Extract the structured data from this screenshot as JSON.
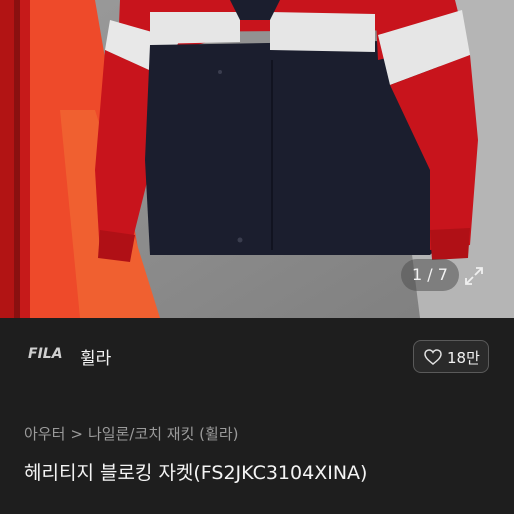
{
  "gallery": {
    "counter": "1 / 7",
    "expand_icon": "expand-arrows-icon"
  },
  "brand": {
    "logo_text": "FILA",
    "name": "휠라",
    "like_icon": "heart-outline-icon",
    "like_count": "18만"
  },
  "breadcrumb": {
    "items": [
      "아우터",
      "나일론/코치 재킷 (휠라)"
    ],
    "separator": ">"
  },
  "product": {
    "title": "헤리티지 블로킹 자켓(FS2JKC3104XINA)"
  },
  "colors": {
    "background": "#1e1e1e",
    "jacket_red": "#c9141c",
    "jacket_navy": "#1a1d2e",
    "reflective_stripe": "#dcdcdc"
  }
}
